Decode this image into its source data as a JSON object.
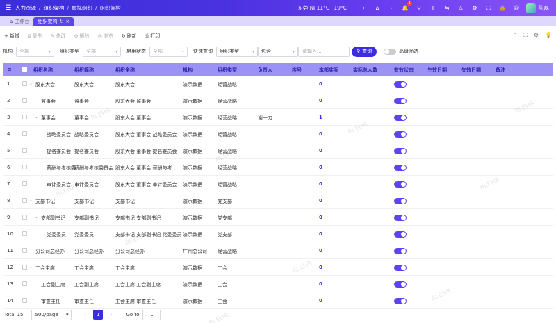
{
  "header": {
    "breadcrumbs": [
      "人力资源",
      "组织架构",
      "虚拟组织",
      "组织架构"
    ],
    "weather": "东莞 晴 11°C~19°C",
    "notification_count": "1",
    "username": "陈磊"
  },
  "tabs": [
    {
      "label": "工作台"
    },
    {
      "label": "组织架构"
    }
  ],
  "toolbar": {
    "add": "新增",
    "copy": "复制",
    "edit": "修改",
    "delete": "删除",
    "browse": "浏览",
    "refresh": "刷新",
    "print": "打印"
  },
  "filters": {
    "org_label": "机构",
    "org_value": "全部",
    "type_label": "组织类型",
    "type_value": "全部",
    "status_label": "启用状态",
    "status_value": "全部",
    "quick_label": "快速查询",
    "quick_field": "组织类型",
    "quick_op": "包含",
    "quick_placeholder": "请输入...",
    "query_button": "查询",
    "advanced": "高级筛选"
  },
  "table": {
    "columns": [
      "组织名称",
      "组织简称",
      "组织全称",
      "机构",
      "组织类型",
      "负责人",
      "序号",
      "本部实际",
      "实际总人数",
      "有效状态",
      "生效日期",
      "失效日期",
      "备注"
    ],
    "rows": [
      {
        "idx": "1",
        "name": "股东大会",
        "short": "股东大会",
        "full": "股东大会",
        "org": "演示数据",
        "type": "经营战略",
        "leader": "",
        "actual": "0",
        "expand": true,
        "indent": 0
      },
      {
        "idx": "2",
        "name": "监事会",
        "short": "监事会",
        "full": "股东大会 监事会",
        "org": "演示数据",
        "type": "经营战略",
        "leader": "",
        "actual": "0",
        "expand": false,
        "indent": 1
      },
      {
        "idx": "3",
        "name": "董事会",
        "short": "董事会",
        "full": "股东大会 董事会",
        "org": "演示数据",
        "type": "经营战略",
        "leader": "谢一刀",
        "actual": "1",
        "expand": true,
        "indent": 1
      },
      {
        "idx": "4",
        "name": "战略委员会",
        "short": "战略委员会",
        "full": "股东大会 董事会 战略委员会",
        "org": "演示数据",
        "type": "经营战略",
        "leader": "",
        "actual": "0",
        "expand": false,
        "indent": 2
      },
      {
        "idx": "5",
        "name": "提名委员会",
        "short": "提名委员会",
        "full": "股东大会 董事会 提名委员会",
        "org": "演示数据",
        "type": "经营战略",
        "leader": "",
        "actual": "0",
        "expand": false,
        "indent": 2
      },
      {
        "idx": "6",
        "name": "薪酬与考核委",
        "short": "薪酬与考核委员会",
        "full": "股东大会 董事会 薪酬与考",
        "org": "演示数据",
        "type": "经营战略",
        "leader": "",
        "actual": "0",
        "expand": false,
        "indent": 2
      },
      {
        "idx": "7",
        "name": "审计委员会",
        "short": "审计委员会",
        "full": "股东大会 董事会 审计委员会",
        "org": "演示数据",
        "type": "经营战略",
        "leader": "",
        "actual": "0",
        "expand": false,
        "indent": 2
      },
      {
        "idx": "8",
        "name": "支部书记",
        "short": "支部书记",
        "full": "支部书记",
        "org": "演示数据",
        "type": "党支部",
        "leader": "",
        "actual": "0",
        "expand": true,
        "indent": 0
      },
      {
        "idx": "9",
        "name": "支部副书记",
        "short": "支部副书记",
        "full": "支部书记 支部副书记",
        "org": "演示数据",
        "type": "党支部",
        "leader": "",
        "actual": "0",
        "expand": true,
        "indent": 1
      },
      {
        "idx": "10",
        "name": "党委委员",
        "short": "党委委员",
        "full": "支部书记 支部副书记 党委委员",
        "org": "演示数据",
        "type": "党支部",
        "leader": "",
        "actual": "0",
        "expand": false,
        "indent": 2
      },
      {
        "idx": "11",
        "name": "分公司总经办",
        "short": "分公司总经办",
        "full": "分公司总经办",
        "org": "广州总公司",
        "type": "经营战略",
        "leader": "",
        "actual": "0",
        "expand": false,
        "indent": 0
      },
      {
        "idx": "12",
        "name": "工会主席",
        "short": "工会主席",
        "full": "工会主席",
        "org": "演示数据",
        "type": "工会",
        "leader": "",
        "actual": "0",
        "expand": true,
        "indent": 0
      },
      {
        "idx": "13",
        "name": "工会副主席",
        "short": "工会副主席",
        "full": "工会主席 工会副主席",
        "org": "演示数据",
        "type": "工会",
        "leader": "",
        "actual": "0",
        "expand": false,
        "indent": 1
      },
      {
        "idx": "14",
        "name": "审查主任",
        "short": "审查主任",
        "full": "工会主席 审查主任",
        "org": "演示数据",
        "type": "工会",
        "leader": "",
        "actual": "0",
        "expand": false,
        "indent": 1
      }
    ]
  },
  "pager": {
    "total": "Total 15",
    "page_size": "500/page",
    "current_page": "1",
    "goto_label": "Go to",
    "goto_value": "1"
  },
  "watermark": "RLEHR"
}
